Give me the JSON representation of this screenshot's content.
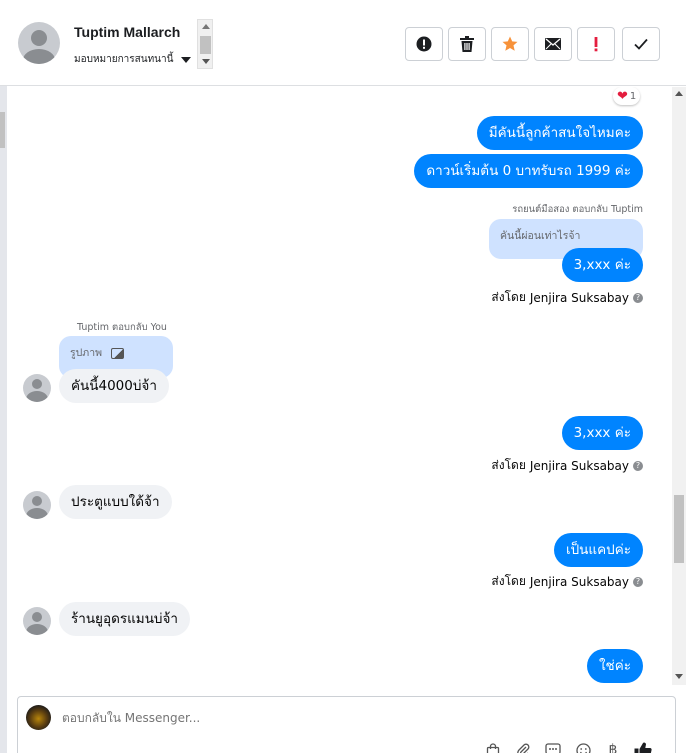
{
  "header": {
    "contact_name": "Tuptim Mallarch",
    "assign_label": "มอบหมายการสนทนานี้"
  },
  "actions": [
    {
      "name": "spam-button",
      "icon": "alert-circle-icon"
    },
    {
      "name": "delete-button",
      "icon": "trash-icon"
    },
    {
      "name": "star-button",
      "icon": "star-icon"
    },
    {
      "name": "mark-unread-button",
      "icon": "envelope-icon"
    },
    {
      "name": "important-button",
      "icon": "exclamation-icon"
    },
    {
      "name": "done-button",
      "icon": "check-icon"
    }
  ],
  "messages": {
    "reaction_count": "1",
    "out1": "มีคันนี้ลูกค้าสนใจไหมคะ",
    "out2": "ดาวน์เริ่มต้น 0 บาทรับรถ 1999 ค่ะ",
    "reply_note1": "รถยนต์มือสอง ตอบกลับ Tuptim",
    "reply_quote1": "คันนี้ผ่อนเท่าไรจ้า",
    "out3": "3,xxx ค่ะ",
    "sent_by_prefix": "ส่งโดย",
    "sent_by_name": "Jenjira Suksabay",
    "reply_note2": "Tuptim ตอบกลับ You",
    "reply_quote2": "รูปภาพ",
    "in1": "คันนี้4000บ่จ้า",
    "out4": "3,xxx ค่ะ",
    "in2": "ประตูแบบใด้จ้า",
    "out5": "เป็นแคปค่ะ",
    "in3": "ร้านยูอุดรแมนบ่จ้า",
    "out6": "ใช่ค่ะ"
  },
  "composer": {
    "placeholder": "ตอบกลับใน Messenger..."
  },
  "colors": {
    "accent": "#0084ff",
    "star": "#f7923a",
    "important": "#e41e3f",
    "reply_bg": "#cfe2ff"
  }
}
